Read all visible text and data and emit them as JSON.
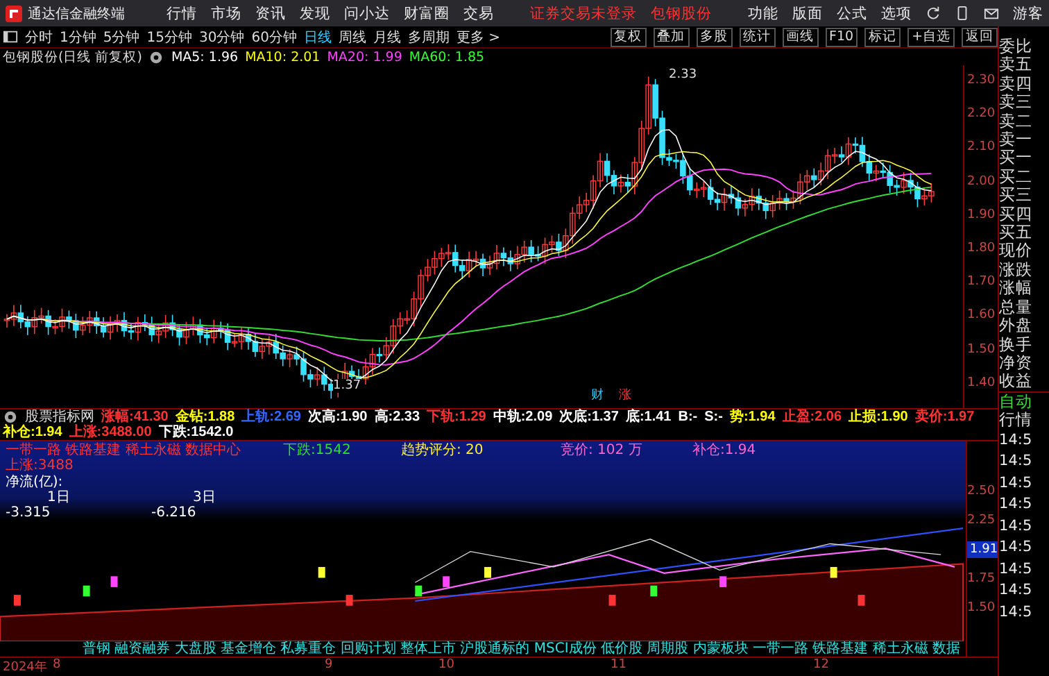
{
  "menu_bar": {
    "app_title": "通达信金融终端",
    "menus": [
      "行情",
      "市场",
      "资讯",
      "发现",
      "问小达",
      "财富圈",
      "交易"
    ],
    "login_status": "证券交易未登录",
    "stock_name": "包钢股份",
    "right_menus": [
      "功能",
      "版面",
      "公式",
      "选项"
    ],
    "user": "游客"
  },
  "toolbar": {
    "periods": [
      {
        "label": "分时",
        "selected": false
      },
      {
        "label": "1分钟",
        "selected": false
      },
      {
        "label": "5分钟",
        "selected": false
      },
      {
        "label": "15分钟",
        "selected": false
      },
      {
        "label": "30分钟",
        "selected": false
      },
      {
        "label": "60分钟",
        "selected": false
      },
      {
        "label": "日线",
        "selected": true
      },
      {
        "label": "周线",
        "selected": false
      },
      {
        "label": "月线",
        "selected": false
      },
      {
        "label": "多周期",
        "selected": false
      },
      {
        "label": "更多 >",
        "selected": false
      }
    ],
    "buttons": [
      "复权",
      "叠加",
      "多股",
      "统计",
      "画线",
      "F10",
      "标记",
      "+自选",
      "返回"
    ]
  },
  "chart_header": {
    "title": "包钢股份(日线 前复权)",
    "averages": [
      {
        "label": "MA5: 1.96",
        "color": "#ffffff"
      },
      {
        "label": "MA10: 2.01",
        "color": "#ffff00"
      },
      {
        "label": "MA20: 1.99",
        "color": "#ff44ff"
      },
      {
        "label": "MA60: 1.85",
        "color": "#33ff33"
      }
    ]
  },
  "main_chart": {
    "price_labels": [
      "2.30",
      "2.20",
      "2.10",
      "2.00",
      "1.90",
      "1.80",
      "1.70",
      "1.60",
      "1.50",
      "1.40"
    ],
    "high_label": "2.33",
    "low_label": "1.37",
    "badges": [
      "财",
      "涨"
    ]
  },
  "indicator_header": {
    "name": "股票指标网",
    "items": [
      {
        "label": "涨幅:41.30",
        "color": "#ff3333"
      },
      {
        "label": "金钻:1.88",
        "color": "#ffff00"
      },
      {
        "label": "上轨:2.69",
        "color": "#3366ff"
      },
      {
        "label": "次高:1.90",
        "color": "#ffffff"
      },
      {
        "label": "高:2.33",
        "color": "#ffffff"
      },
      {
        "label": "下轨:1.29",
        "color": "#ff3333"
      },
      {
        "label": "中轨:2.09",
        "color": "#ffffff"
      },
      {
        "label": "次底:1.37",
        "color": "#ffffff"
      },
      {
        "label": "底:1.41",
        "color": "#ffffff"
      },
      {
        "label": "B:-",
        "color": "#ffffff"
      },
      {
        "label": "S:-",
        "color": "#ffffff"
      },
      {
        "label": "势:1.94",
        "color": "#ffff00"
      },
      {
        "label": "止盈:2.06",
        "color": "#ff3333"
      },
      {
        "label": "止损:1.90",
        "color": "#ffff00"
      },
      {
        "label": "卖价:1.97",
        "color": "#ff3333"
      },
      {
        "label": "补仓:1.94",
        "color": "#ffff00"
      },
      {
        "label": "上涨:3488.00",
        "color": "#ff3333"
      },
      {
        "label": "下跌:1542.0",
        "color": "#ffffff"
      }
    ]
  },
  "info_panel": {
    "concepts": "一带一路 铁路基建 稀土永磁 数据中心",
    "rise": "上涨:3488",
    "fall": "下跌:1542",
    "trend_score": "趋势评分:  20",
    "auction": "竞价: 102 万",
    "add_position": "补仓:1.94",
    "net_flow_label": "净流(亿):",
    "flows": [
      {
        "period": "1日",
        "value": "-3.315"
      },
      {
        "period": "3日",
        "value": "-6.216"
      }
    ]
  },
  "lower_chart": {
    "price_labels": [
      {
        "label": "2.50",
        "selected": false
      },
      {
        "label": "2.25",
        "selected": false
      },
      {
        "label": "1.91",
        "selected": true
      },
      {
        "label": "1.75",
        "selected": false
      },
      {
        "label": "1.50",
        "selected": false
      }
    ],
    "tags": "普钢 融资融券 大盘股 基金增仓 私募重仓 回购计划 整体上市 沪股通标的 MSCI成份 低价股 周期股 内蒙板块 一带一路 铁路基建 稀土永磁 数据"
  },
  "date_axis": [
    "2024年",
    "8",
    "9",
    "10",
    "11",
    "12"
  ],
  "side_panel": {
    "quote_labels": [
      "委比",
      "卖五",
      "卖四",
      "卖三",
      "卖二",
      "卖一",
      "买一",
      "买二",
      "买三",
      "买四",
      "买五",
      "现价",
      "涨跌",
      "涨幅",
      "总量",
      "外盘",
      "换手",
      "净资",
      "收益"
    ],
    "mode_labels": [
      "自动",
      "行情"
    ],
    "times": [
      "14:5",
      "14:5",
      "14:5",
      "14:5",
      "14:5",
      "14:5",
      "14:5",
      "14:5",
      "14:5"
    ]
  }
}
